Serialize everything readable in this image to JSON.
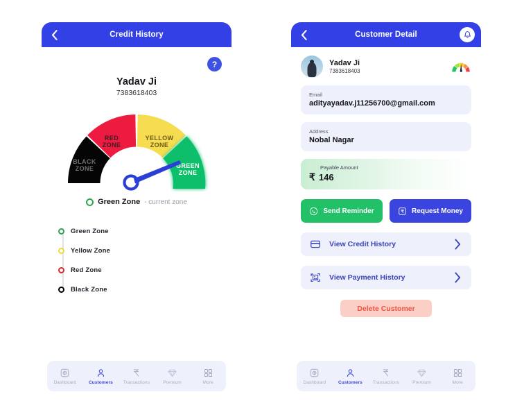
{
  "theme": {
    "header_blue": "#3240e6",
    "accent_blue": "#3a45e0",
    "card_bg": "#eef1fc",
    "green": "#22c168",
    "danger_pink": "#fbcec6",
    "danger_red": "#ef5541"
  },
  "left_screen": {
    "appbar": {
      "title": "Credit History",
      "back_icon": "chevron-left-icon"
    },
    "help_button": {
      "label": "?",
      "icon": "help-icon"
    },
    "customer": {
      "name": "Yadav Ji",
      "phone": "7383618403"
    },
    "gauge": {
      "zones": [
        {
          "key": "black",
          "label_line1": "BLACK",
          "label_line2": "ZONE",
          "color": "#050505",
          "text_color": "#6f7076"
        },
        {
          "key": "red",
          "label_line1": "RED",
          "label_line2": "ZONE",
          "color": "#ed1b40",
          "text_color": "#3b1d24"
        },
        {
          "key": "yellow",
          "label_line1": "YELLOW",
          "label_line2": "ZONE",
          "color": "#f5dc50",
          "text_color": "#6b5a16"
        },
        {
          "key": "green",
          "label_line1": "GREEN",
          "label_line2": "ZONE",
          "color": "#0fbf6b",
          "text_color": "#ffffff"
        }
      ],
      "needle_color": "#2b3fd6",
      "needle_points_to": "green"
    },
    "current_zone": {
      "label": "Green Zone",
      "suffix": "- current zone",
      "color": "#2ea44f"
    },
    "zone_legend": [
      {
        "label": "Green Zone",
        "color": "#2ea44f"
      },
      {
        "label": "Yellow Zone",
        "color": "#edd83c"
      },
      {
        "label": "Red Zone",
        "color": "#da2b2b"
      },
      {
        "label": "Black Zone",
        "color": "#000000"
      }
    ],
    "bottom_nav": [
      {
        "label": "Dashboard",
        "icon": "dashboard-icon",
        "active": false
      },
      {
        "label": "Customers",
        "icon": "user-icon",
        "active": true
      },
      {
        "label": "Transactions",
        "icon": "rupee-icon",
        "active": false
      },
      {
        "label": "Premium",
        "icon": "diamond-icon",
        "active": false
      },
      {
        "label": "More",
        "icon": "grid-icon",
        "active": false
      }
    ]
  },
  "right_screen": {
    "appbar": {
      "title": "Customer Detail",
      "back_icon": "chevron-left-icon",
      "bell_icon": "bell-icon"
    },
    "profile": {
      "name": "Yadav Ji",
      "phone": "7383618403",
      "avatar_icon": "avatar",
      "score_gauge_icon": "speedometer-icon"
    },
    "fields": [
      {
        "label": "Email",
        "value": "adityayadav.j11256700@gmail.com"
      },
      {
        "label": "Address",
        "value": "Nobal Nagar"
      }
    ],
    "payable": {
      "label": "Payable Amount",
      "currency": "₹",
      "amount": "146"
    },
    "actions": [
      {
        "label": "Send Reminder",
        "icon": "whatsapp-icon",
        "style": "green"
      },
      {
        "label": "Request Money",
        "icon": "rupee-box-icon",
        "style": "blue"
      }
    ],
    "links": [
      {
        "label": "View Credit History",
        "icon": "credit-card-icon",
        "chevron": "chevron-right-icon"
      },
      {
        "label": "View Payment History",
        "icon": "image-icon",
        "chevron": "chevron-right-icon"
      }
    ],
    "delete_button": {
      "label": "Delete Customer"
    },
    "bottom_nav": [
      {
        "label": "Dashboard",
        "icon": "dashboard-icon",
        "active": false
      },
      {
        "label": "Customers",
        "icon": "user-icon",
        "active": true
      },
      {
        "label": "Transactions",
        "icon": "rupee-icon",
        "active": false
      },
      {
        "label": "Premium",
        "icon": "diamond-icon",
        "active": false
      },
      {
        "label": "More",
        "icon": "grid-icon",
        "active": false
      }
    ]
  },
  "chart_data": {
    "type": "pie",
    "title": "Credit Zone Gauge",
    "subtype": "half-donut-gauge",
    "categories": [
      "Black Zone",
      "Red Zone",
      "Yellow Zone",
      "Green Zone"
    ],
    "values": [
      25,
      25,
      25,
      25
    ],
    "colors": [
      "#050505",
      "#ed1b40",
      "#f5dc50",
      "#0fbf6b"
    ],
    "current_value": "Green Zone",
    "needle_angle_deg": 40,
    "legend_position": "below",
    "grid": false
  }
}
